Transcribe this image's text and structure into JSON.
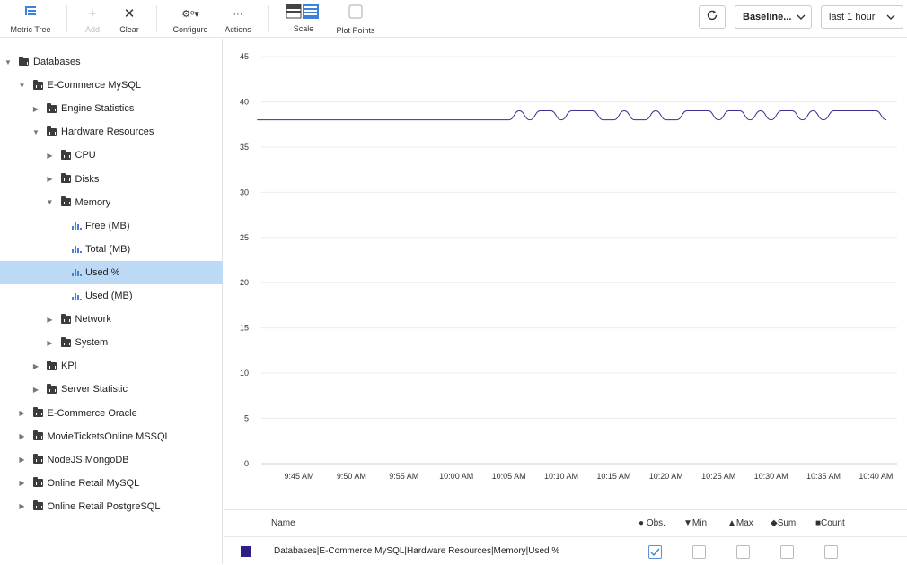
{
  "toolbar": {
    "metric_tree_label": "Metric Tree",
    "add_label": "Add",
    "clear_label": "Clear",
    "configure_label": "Configure",
    "actions_label": "Actions",
    "scale_label": "Scale",
    "plot_points_label": "Plot Points",
    "baseline_value": "Baseline...",
    "range_value": "last 1 hour"
  },
  "tree": [
    {
      "label": "Databases",
      "level": 0,
      "expanded": true,
      "kind": "folder"
    },
    {
      "label": "E-Commerce MySQL",
      "level": 1,
      "expanded": true,
      "kind": "folder"
    },
    {
      "label": "Engine Statistics",
      "level": 2,
      "expanded": false,
      "kind": "folder"
    },
    {
      "label": "Hardware Resources",
      "level": 2,
      "expanded": true,
      "kind": "folder"
    },
    {
      "label": "CPU",
      "level": 3,
      "expanded": false,
      "kind": "folder"
    },
    {
      "label": "Disks",
      "level": 3,
      "expanded": false,
      "kind": "folder"
    },
    {
      "label": "Memory",
      "level": 3,
      "expanded": true,
      "kind": "folder"
    },
    {
      "label": "Free (MB)",
      "level": 4,
      "kind": "metric"
    },
    {
      "label": "Total (MB)",
      "level": 4,
      "kind": "metric"
    },
    {
      "label": "Used %",
      "level": 4,
      "kind": "metric",
      "selected": true
    },
    {
      "label": "Used (MB)",
      "level": 4,
      "kind": "metric"
    },
    {
      "label": "Network",
      "level": 3,
      "expanded": false,
      "kind": "folder"
    },
    {
      "label": "System",
      "level": 3,
      "expanded": false,
      "kind": "folder"
    },
    {
      "label": "KPI",
      "level": 2,
      "expanded": false,
      "kind": "folder"
    },
    {
      "label": "Server Statistic",
      "level": 2,
      "expanded": false,
      "kind": "folder"
    },
    {
      "label": "E-Commerce Oracle",
      "level": 1,
      "expanded": false,
      "kind": "folder"
    },
    {
      "label": "MovieTicketsOnline MSSQL",
      "level": 1,
      "expanded": false,
      "kind": "folder"
    },
    {
      "label": "NodeJS MongoDB",
      "level": 1,
      "expanded": false,
      "kind": "folder"
    },
    {
      "label": "Online Retail MySQL",
      "level": 1,
      "expanded": false,
      "kind": "folder"
    },
    {
      "label": "Online Retail PostgreSQL",
      "level": 1,
      "expanded": false,
      "kind": "folder"
    }
  ],
  "chart_data": {
    "type": "line",
    "ylim": [
      0,
      45
    ],
    "yticks": [
      "0",
      "5",
      "10",
      "15",
      "20",
      "25",
      "30",
      "35",
      "40",
      "45"
    ],
    "xticks": [
      "9:45 AM",
      "9:50 AM",
      "9:55 AM",
      "10:00 AM",
      "10:05 AM",
      "10:10 AM",
      "10:15 AM",
      "10:20 AM",
      "10:25 AM",
      "10:30 AM",
      "10:35 AM",
      "10:40 AM"
    ],
    "grid": true,
    "series": [
      {
        "color": "#3b2f8f",
        "x": [
          "9:41 AM",
          "9:45 AM",
          "9:50 AM",
          "9:55 AM",
          "10:00 AM",
          "10:05 AM",
          "10:06 AM",
          "10:07 AM",
          "10:08 AM",
          "10:09 AM",
          "10:10 AM",
          "10:11 AM",
          "10:12 AM",
          "10:13 AM",
          "10:14 AM",
          "10:15 AM",
          "10:16 AM",
          "10:17 AM",
          "10:18 AM",
          "10:19 AM",
          "10:20 AM",
          "10:21 AM",
          "10:22 AM",
          "10:23 AM",
          "10:24 AM",
          "10:25 AM",
          "10:26 AM",
          "10:27 AM",
          "10:28 AM",
          "10:29 AM",
          "10:30 AM",
          "10:31 AM",
          "10:32 AM",
          "10:33 AM",
          "10:34 AM",
          "10:35 AM",
          "10:36 AM",
          "10:37 AM",
          "10:38 AM",
          "10:39 AM",
          "10:40 AM",
          "10:41 AM"
        ],
        "values": [
          38,
          38,
          38,
          38,
          38,
          38,
          39,
          38,
          39,
          39,
          38,
          39,
          39,
          39,
          38,
          38,
          39,
          38,
          38,
          39,
          38,
          38,
          39,
          39,
          39,
          38,
          39,
          39,
          38,
          39,
          38,
          39,
          39,
          38,
          39,
          38,
          39,
          39,
          39,
          39,
          39,
          38
        ]
      }
    ]
  },
  "legend": {
    "col_name": "Name",
    "col_obs": "Obs.",
    "col_min": "Min",
    "col_max": "Max",
    "col_sum": "Sum",
    "col_count": "Count",
    "row_name": "Databases|E-Commerce MySQL|Hardware Resources|Memory|Used %",
    "row_color": "#2e1f88",
    "obs_checked": true
  }
}
